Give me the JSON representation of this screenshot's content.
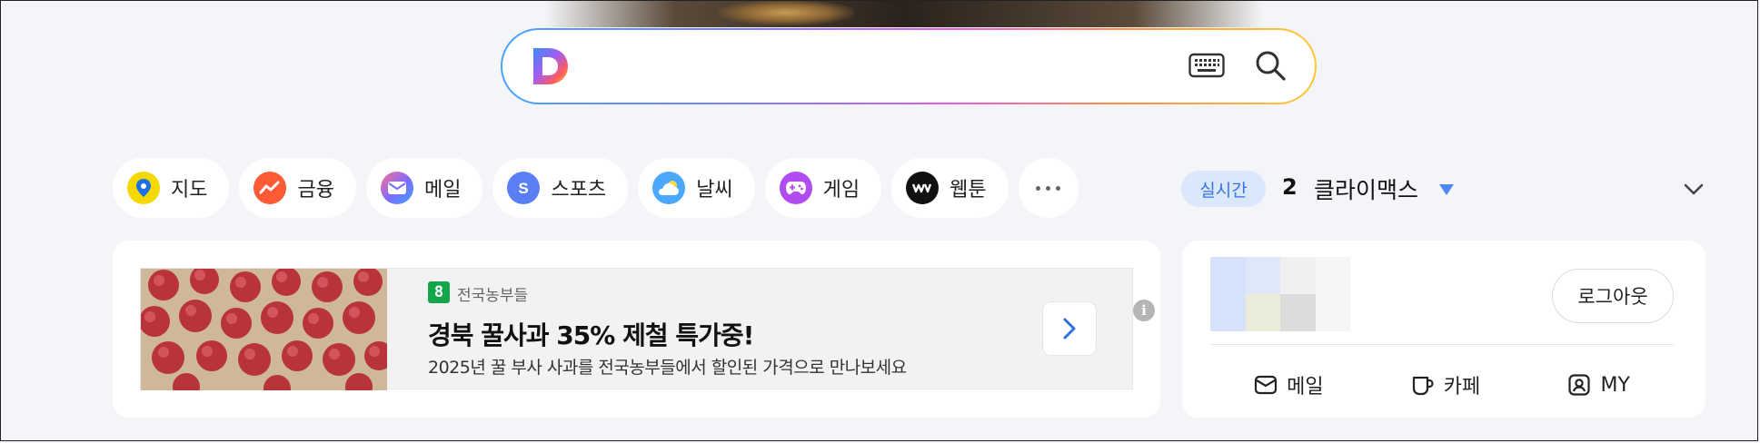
{
  "search": {
    "placeholder": ""
  },
  "categories": [
    {
      "label": "지도",
      "icon": "map-pin-icon",
      "color": "#f5d800"
    },
    {
      "label": "금융",
      "icon": "finance-chart-icon",
      "color": "#ff5a36"
    },
    {
      "label": "메일",
      "icon": "mail-icon",
      "color": "#7b6cff"
    },
    {
      "label": "스포츠",
      "icon": "sports-icon",
      "color": "#5b7ef5"
    },
    {
      "label": "날씨",
      "icon": "weather-icon",
      "color": "#4aa8ff"
    },
    {
      "label": "게임",
      "icon": "game-icon",
      "color": "#b04cf0"
    },
    {
      "label": "웹툰",
      "icon": "webtoon-icon",
      "color": "#111111"
    }
  ],
  "realtime": {
    "badge": "실시간",
    "rank": "2",
    "term": "클라이맥스"
  },
  "ad": {
    "brand": "전국농부들",
    "brand_logo": "8",
    "title": "경북 꿀사과 35% 제철 특가중!",
    "description": "2025년 꿀 부사 사과를 전국농부들에서 할인된 가격으로 만나보세요",
    "info": "i"
  },
  "account": {
    "logout_label": "로그아웃",
    "links": [
      {
        "label": "메일",
        "icon": "mail-icon"
      },
      {
        "label": "카페",
        "icon": "cafe-cup-icon"
      },
      {
        "label": "MY",
        "icon": "profile-icon"
      }
    ]
  },
  "colors": {
    "accent": "#3775e6",
    "background": "#f4f5f8",
    "brand_green": "#13a64b"
  }
}
